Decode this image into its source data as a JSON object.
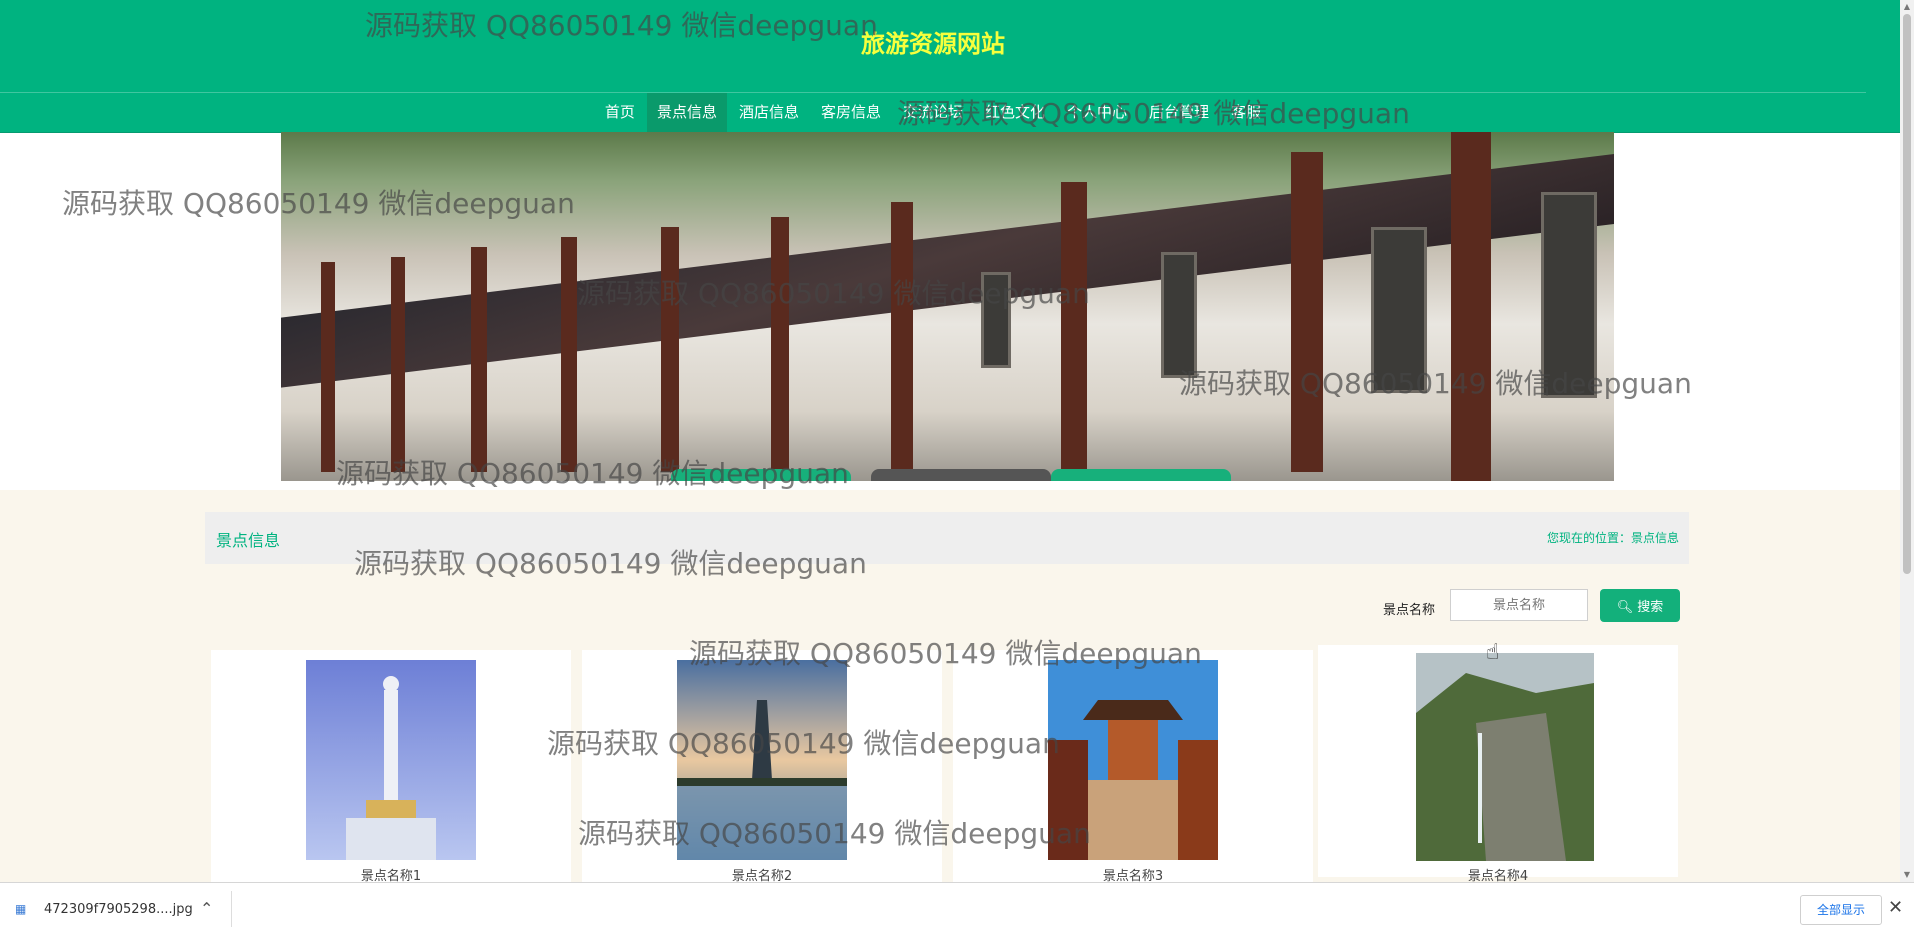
{
  "header": {
    "site_title": "旅游资源网站",
    "nav": [
      {
        "label": "首页",
        "active": false
      },
      {
        "label": "景点信息",
        "active": true
      },
      {
        "label": "酒店信息",
        "active": false
      },
      {
        "label": "客房信息",
        "active": false
      },
      {
        "label": "交流论坛",
        "active": false
      },
      {
        "label": "红色文化",
        "active": false
      },
      {
        "label": "个人中心",
        "active": false
      },
      {
        "label": "后台管理",
        "active": false
      },
      {
        "label": "客服",
        "active": false
      }
    ]
  },
  "page": {
    "section_title": "景点信息",
    "location_label": "您现在的位置：",
    "location_value": "景点信息"
  },
  "search": {
    "label": "景点名称",
    "placeholder": "景点名称",
    "button_label": "搜索",
    "icon": "search-icon"
  },
  "cards": [
    {
      "caption": "景点名称1"
    },
    {
      "caption": "景点名称2"
    },
    {
      "caption": "景点名称3"
    },
    {
      "caption": "景点名称4"
    }
  ],
  "download_bar": {
    "file_name": "472309f7905298....jpg",
    "show_all": "全部显示"
  },
  "watermarks": [
    "源码获取 QQ86050149 微信deepguan",
    "源码获取 QQ86050149 微信deepguan",
    "源码获取 QQ86050149 微信deepguan",
    "源码获取 QQ86050149 微信deepguan",
    "源码获取 QQ86050149 微信deepguan",
    "源码获取 QQ86050149 微信deepguan",
    "源码获取 QQ86050149 微信deepguan",
    "源码获取 QQ86050149 微信deepguan",
    "源码获取 QQ86050149 微信deepguan",
    "源码获取 QQ86050149 微信deepguan"
  ],
  "colors": {
    "brand": "#00b380",
    "title_yellow": "#f6ff3d",
    "content_bg": "#faf6ec"
  }
}
